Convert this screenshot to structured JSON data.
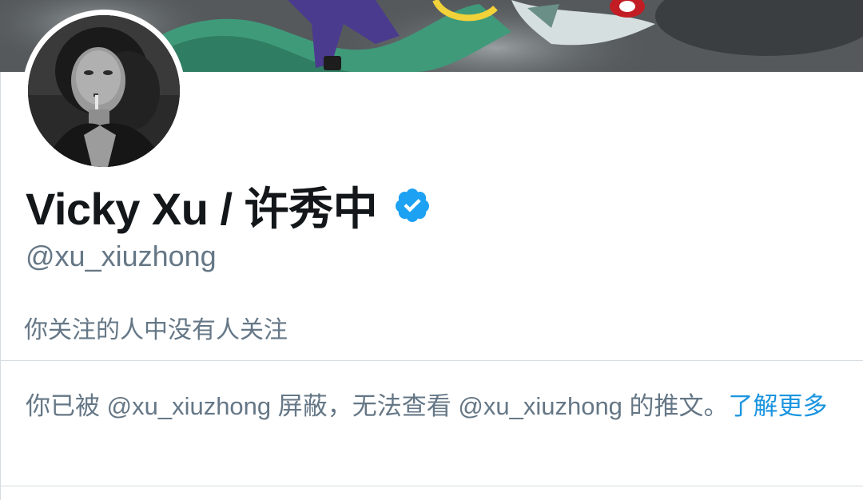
{
  "profile": {
    "display_name": "Vicky Xu / 许秀中",
    "handle": "@xu_xiuzhong",
    "verified_icon": "verified-badge-icon",
    "followers_you_follow": "你关注的人中没有人关注"
  },
  "blocked_notice": {
    "message": "你已被 @xu_xiuzhong 屏蔽，无法查看 @xu_xiuzhong 的推文。",
    "link_label": "了解更多"
  },
  "colors": {
    "name": "#14171a",
    "secondary_text": "#657786",
    "link": "#1b95e0",
    "verified": "#1da1f2",
    "divider": "#d6dbdf"
  }
}
